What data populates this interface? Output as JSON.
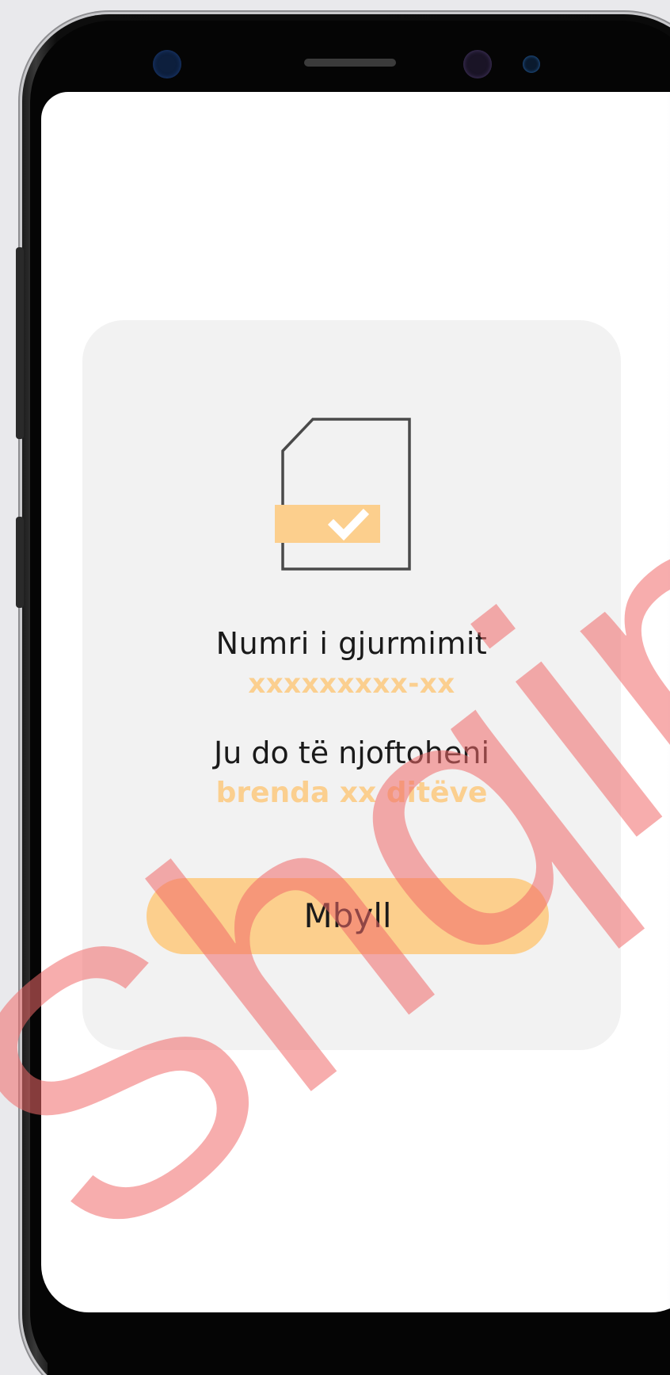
{
  "dialog": {
    "tracking_label": "Numri i gjurmimit",
    "tracking_number": "xxxxxxxxx-xx",
    "notify_label": "Ju do të njoftoheni",
    "notify_time": "brenda xx ditëve",
    "close_label": "Mbyll",
    "icon": "document-check-icon"
  },
  "watermark": {
    "text": "Shqipt"
  },
  "colors": {
    "accent": "#fccf8d",
    "accent_text": "#fbcf8f",
    "card_bg": "#f2f2f2",
    "watermark": "#f06a6a"
  }
}
